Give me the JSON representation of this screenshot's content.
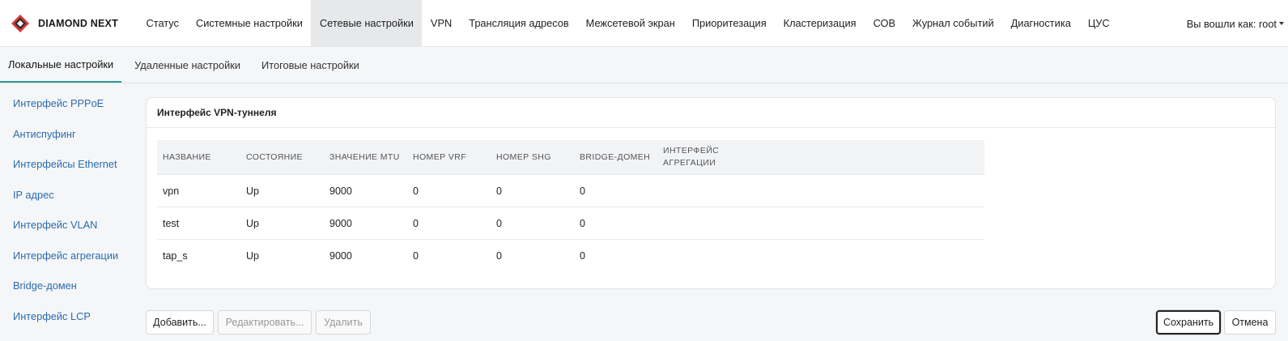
{
  "brand": {
    "name": "DIAMOND NEXT",
    "logo_icon": "diamond-logo-icon"
  },
  "nav": {
    "items": [
      {
        "label": "Статус"
      },
      {
        "label": "Системные настройки"
      },
      {
        "label": "Сетевые настройки",
        "active": true
      },
      {
        "label": "VPN"
      },
      {
        "label": "Трансляция адресов"
      },
      {
        "label": "Межсетевой экран"
      },
      {
        "label": "Приоритезация"
      },
      {
        "label": "Кластеризация"
      },
      {
        "label": "СОВ"
      },
      {
        "label": "Журнал событий"
      },
      {
        "label": "Диагностика"
      },
      {
        "label": "ЦУС"
      }
    ],
    "user_label": "Вы вошли как: root"
  },
  "subtabs": [
    {
      "label": "Локальные настройки",
      "active": true
    },
    {
      "label": "Удаленные настройки"
    },
    {
      "label": "Итоговые настройки"
    }
  ],
  "sidebar": {
    "items": [
      {
        "label": "Интерфейс PPPoE"
      },
      {
        "label": "Антиспуфинг"
      },
      {
        "label": "Интерфейсы Ethernet"
      },
      {
        "label": "IP адрес"
      },
      {
        "label": "Интерфейс VLAN"
      },
      {
        "label": "Интерфейс агрегации"
      },
      {
        "label": "Bridge-домен"
      },
      {
        "label": "Интерфейс LCP"
      }
    ]
  },
  "panel": {
    "title": "Интерфейс VPN-туннеля",
    "columns": [
      "НАЗВАНИЕ",
      "СОСТОЯНИЕ",
      "ЗНАЧЕНИЕ MTU",
      "НОМЕР VRF",
      "НОМЕР SHG",
      "BRIDGE-ДОМЕН",
      "ИНТЕРФЕЙС АГРЕГАЦИИ"
    ],
    "rows": [
      [
        "vpn",
        "Up",
        "9000",
        "0",
        "0",
        "0",
        ""
      ],
      [
        "test",
        "Up",
        "9000",
        "0",
        "0",
        "0",
        ""
      ],
      [
        "tap_s",
        "Up",
        "9000",
        "0",
        "0",
        "0",
        ""
      ]
    ]
  },
  "actions": {
    "add": "Добавить...",
    "edit": "Редактировать...",
    "delete": "Удалить",
    "save": "Сохранить",
    "cancel": "Отмена"
  },
  "colors": {
    "link": "#2a6bb0",
    "accent": "#2a9d8f",
    "logo_red": "#d23a3a"
  }
}
